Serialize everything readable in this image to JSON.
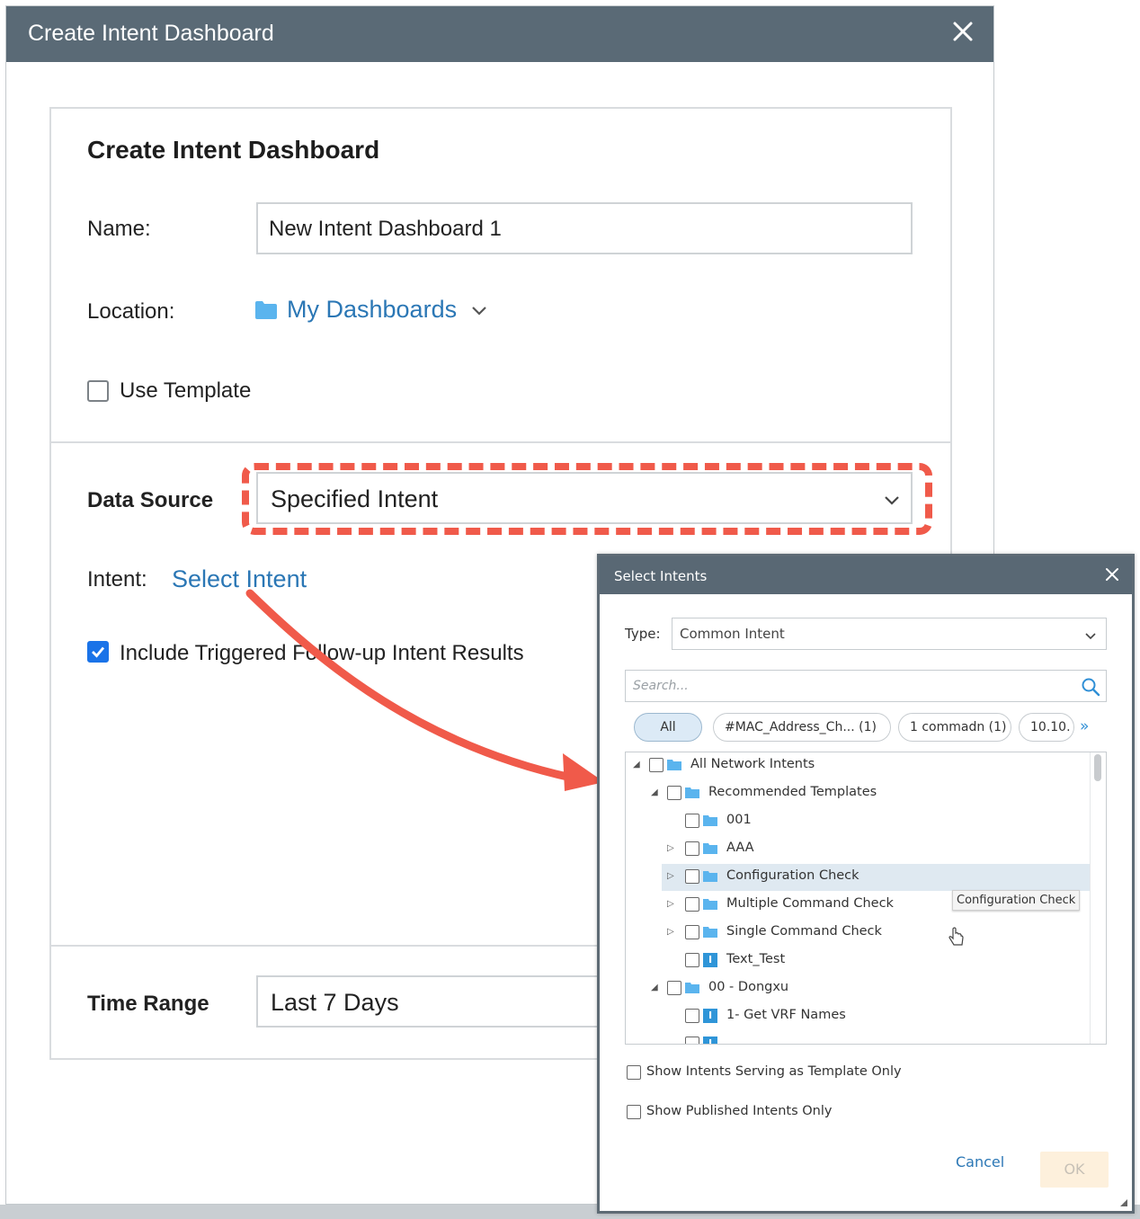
{
  "main_dialog": {
    "window_title": "Create Intent Dashboard",
    "panel_title": "Create Intent Dashboard",
    "name_label": "Name:",
    "name_value": "New Intent Dashboard 1",
    "location_label": "Location:",
    "location_value": "My Dashboards",
    "use_template_label": "Use Template",
    "use_template_checked": false,
    "data_source_label": "Data Source",
    "data_source_value": "Specified Intent",
    "intent_label": "Intent:",
    "select_intent_link": "Select Intent",
    "include_followup_label": "Include Triggered Follow-up Intent Results",
    "include_followup_checked": true,
    "time_range_label": "Time Range",
    "time_range_value": "Last 7 Days"
  },
  "select_dialog": {
    "title": "Select Intents",
    "type_label": "Type:",
    "type_value": "Common Intent",
    "search_placeholder": "Search...",
    "chips": [
      "All",
      "#MAC_Address_Ch...  (1)",
      "1 commadn (1)",
      "10.10."
    ],
    "tree": [
      {
        "label": "All Network Intents",
        "kind": "folder",
        "expander": "expanded"
      },
      {
        "label": "Recommended Templates",
        "kind": "folder",
        "expander": "expanded"
      },
      {
        "label": "001",
        "kind": "folder",
        "expander": "none"
      },
      {
        "label": "AAA",
        "kind": "folder",
        "expander": "collapsed"
      },
      {
        "label": "Configuration Check",
        "kind": "folder",
        "expander": "collapsed",
        "hovered": true
      },
      {
        "label": "Multiple Command Check",
        "kind": "folder",
        "expander": "collapsed"
      },
      {
        "label": "Single Command Check",
        "kind": "folder",
        "expander": "collapsed"
      },
      {
        "label": "Text_Test",
        "kind": "intent",
        "expander": "none"
      },
      {
        "label": "00 - Dongxu",
        "kind": "folder",
        "expander": "expanded"
      },
      {
        "label": "1- Get VRF Names",
        "kind": "intent",
        "expander": "none"
      }
    ],
    "tooltip": "Configuration Check",
    "show_template_only_label": "Show Intents Serving as Template Only",
    "show_published_only_label": "Show Published Intents Only",
    "cancel_label": "Cancel",
    "ok_label": "OK"
  },
  "colors": {
    "header": "#5a6a76",
    "link": "#2b77b5",
    "highlight": "#f05a4a",
    "checkbox_checked": "#1a73e8"
  }
}
